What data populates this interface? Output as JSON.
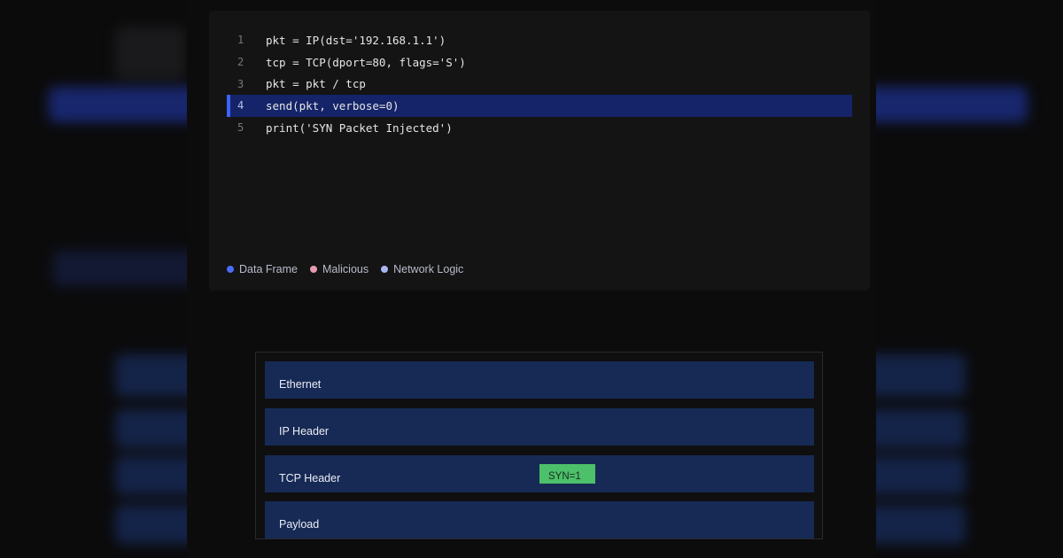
{
  "code": {
    "lines": [
      {
        "number": "1",
        "text": "pkt = IP(dst='192.168.1.1')"
      },
      {
        "number": "2",
        "text": "tcp = TCP(dport=80, flags='S')"
      },
      {
        "number": "3",
        "text": "pkt = pkt / tcp"
      },
      {
        "number": "4",
        "text": "send(pkt, verbose=0)"
      },
      {
        "number": "5",
        "text": "print('SYN Packet Injected')"
      }
    ],
    "active_line": 4
  },
  "legend": [
    {
      "label": "Data Frame",
      "color": "#4a6cf7"
    },
    {
      "label": "Malicious",
      "color": "#e79bb0"
    },
    {
      "label": "Network Logic",
      "color": "#a8b6f5"
    }
  ],
  "packet": {
    "layers": [
      {
        "label": "Ethernet"
      },
      {
        "label": "IP Header"
      },
      {
        "label": "TCP Header"
      },
      {
        "label": "Payload"
      }
    ],
    "flag": "SYN=1"
  },
  "colors": {
    "background": "#0b0b0c",
    "code_panel": "#141414",
    "active_line": "#152468",
    "active_marker": "#3d63ff",
    "layer_fill": "#172a55",
    "flag_fill": "#4cc06a"
  }
}
